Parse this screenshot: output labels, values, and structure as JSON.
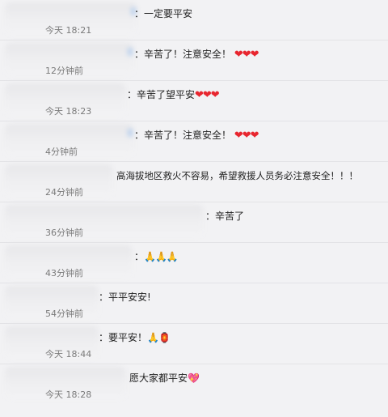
{
  "comments": [
    {
      "text": "：一定要平安",
      "time": "今天 18:21"
    },
    {
      "text": "：辛苦了！注意安全！",
      "emoji": "❤❤❤",
      "time": "12分钟前"
    },
    {
      "text": "：辛苦了望平安",
      "emoji": "❤❤❤",
      "time": "今天 18:23"
    },
    {
      "text": "：辛苦了！注意安全！",
      "emoji": "❤❤❤",
      "time": "4分钟前"
    },
    {
      "text": "高海拔地区救火不容易，希望救援人员务必注意安全！！！",
      "time": "24分钟前"
    },
    {
      "text": "：辛苦了",
      "time": "36分钟前"
    },
    {
      "text": "：",
      "emoji": "🙏🙏🙏",
      "time": "43分钟前"
    },
    {
      "text": "：平平安安!",
      "time": "54分钟前"
    },
    {
      "text": "：要平安！",
      "emoji": "🙏🏮",
      "time": "今天 18:44"
    },
    {
      "text": "愿大家都平安",
      "emoji": "💖",
      "time": "今天 18:28"
    }
  ]
}
